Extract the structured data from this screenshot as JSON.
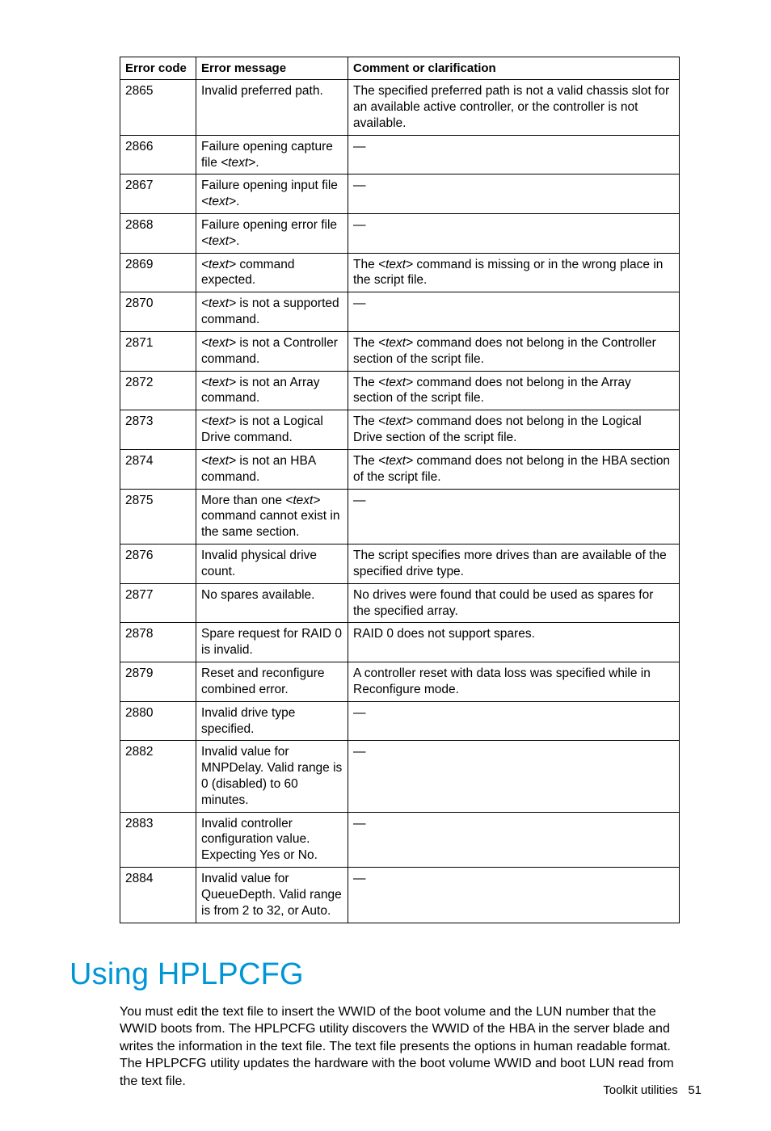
{
  "table": {
    "headers": {
      "code": "Error code",
      "msg": "Error message",
      "comment": "Comment or clarification"
    },
    "rows": [
      {
        "code": "2865",
        "msg": "Invalid preferred path.",
        "comment": "The specified preferred path is not a valid chassis slot for an available active controller, or the controller is not available."
      },
      {
        "code": "2866",
        "msg_pre": "Failure opening capture file ",
        "msg_i": "<text>",
        "msg_post": ".",
        "comment": "—"
      },
      {
        "code": "2867",
        "msg_pre": "Failure opening input file ",
        "msg_i": "<text>",
        "msg_post": ".",
        "comment": "—"
      },
      {
        "code": "2868",
        "msg_pre": "Failure opening error file ",
        "msg_i": "<text>",
        "msg_post": ".",
        "comment": "—"
      },
      {
        "code": "2869",
        "msg_i": "<text>",
        "msg_post": " command expected.",
        "c_pre": "The ",
        "c_i": "<text>",
        "c_post": " command is missing or in the wrong place in the script file."
      },
      {
        "code": "2870",
        "msg_i": "<text>",
        "msg_post": " is not a supported command.",
        "comment": "—"
      },
      {
        "code": "2871",
        "msg_i": "<text>",
        "msg_post": " is not a Controller command.",
        "c_pre": "The ",
        "c_i": "<text>",
        "c_post": " command does not belong in the Controller section of the script file."
      },
      {
        "code": "2872",
        "msg_i": "<text>",
        "msg_post": " is not an Array command.",
        "c_pre": "The ",
        "c_i": "<text>",
        "c_post": " command does not belong in the Array section of the script file."
      },
      {
        "code": "2873",
        "msg_i": "<text>",
        "msg_post": " is not a Logical Drive command.",
        "c_pre": "The ",
        "c_i": "<text>",
        "c_post": " command does not belong in the Logical Drive section of the script file."
      },
      {
        "code": "2874",
        "msg_i": "<text>",
        "msg_post": " is not an HBA command.",
        "c_pre": "The ",
        "c_i": "<text>",
        "c_post": " command does not belong in the HBA section of the script file."
      },
      {
        "code": "2875",
        "msg_pre": "More than one ",
        "msg_i": "<text>",
        "msg_post": " command cannot exist in the same section.",
        "comment": "—"
      },
      {
        "code": "2876",
        "msg": "Invalid physical drive count.",
        "comment": "The script specifies more drives than are available of the specified drive type."
      },
      {
        "code": "2877",
        "msg": "No spares available.",
        "comment": "No drives were found that could be used as spares for the specified array."
      },
      {
        "code": "2878",
        "msg": "Spare request for RAID 0 is invalid.",
        "comment": "RAID 0 does not support spares."
      },
      {
        "code": "2879",
        "msg": "Reset and reconfigure combined error.",
        "comment": "A controller reset with data loss was specified while in Reconfigure mode."
      },
      {
        "code": "2880",
        "msg": "Invalid drive type specified.",
        "comment": "—"
      },
      {
        "code": "2882",
        "msg": "Invalid value for MNPDelay. Valid range is 0 (disabled) to 60 minutes.",
        "comment": "—"
      },
      {
        "code": "2883",
        "msg": "Invalid controller configuration value. Expecting Yes or No.",
        "comment": "—"
      },
      {
        "code": "2884",
        "msg": "Invalid value for QueueDepth. Valid range is from 2 to 32, or Auto.",
        "comment": "—"
      }
    ]
  },
  "section": {
    "title": "Using HPLPCFG",
    "body": "You must edit the text file to insert the WWID of the boot volume and the LUN number that the WWID boots from. The HPLPCFG utility discovers the WWID of the HBA in the server blade and writes the information in the text file. The text file presents the options in human readable format. The HPLPCFG utility updates the hardware with the boot volume WWID and boot LUN read from the text file."
  },
  "footer": {
    "label": "Toolkit utilities",
    "page": "51"
  }
}
